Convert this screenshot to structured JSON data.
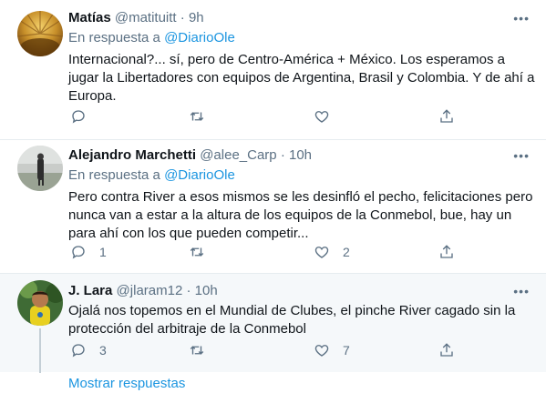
{
  "tweets": [
    {
      "name": "Matías",
      "handle": "@matituitt",
      "sep": "·",
      "time": "9h",
      "reply_prefix": "En respuesta a",
      "reply_to": "@DiarioOle",
      "text": "Internacional?... sí, pero de Centro-América + México. Los esperamos a jugar la Libertadores con equipos de Argentina, Brasil y Colombia. Y de ahí a Europa.",
      "replies": "",
      "retweets": "",
      "likes": ""
    },
    {
      "name": "Alejandro Marchetti",
      "handle": "@alee_Carp",
      "sep": "·",
      "time": "10h",
      "reply_prefix": "En respuesta a",
      "reply_to": "@DiarioOle",
      "text": "Pero contra River a esos mismos se les desinfló el pecho, felicitaciones pero nunca van a estar a la altura de los equipos de la Conmebol, bue, hay un para ahí con los que pueden competir...",
      "replies": "1",
      "retweets": "",
      "likes": "2"
    },
    {
      "name": "J. Lara",
      "handle": "@jlaram12",
      "sep": "·",
      "time": "10h",
      "text": "Ojalá nos topemos en el Mundial de Clubes, el pinche River cagado sin la protección del arbitraje de la Conmebol",
      "replies": "3",
      "retweets": "",
      "likes": "7"
    }
  ],
  "more_replies": "Mostrar respuestas",
  "icons": {
    "more": "more-icon",
    "reply": "reply-icon",
    "retweet": "retweet-icon",
    "like": "like-icon",
    "share": "share-icon"
  },
  "colors": {
    "link": "#1b95e0",
    "muted": "#5b7083",
    "highlight_bg": "#f5f8fa"
  }
}
